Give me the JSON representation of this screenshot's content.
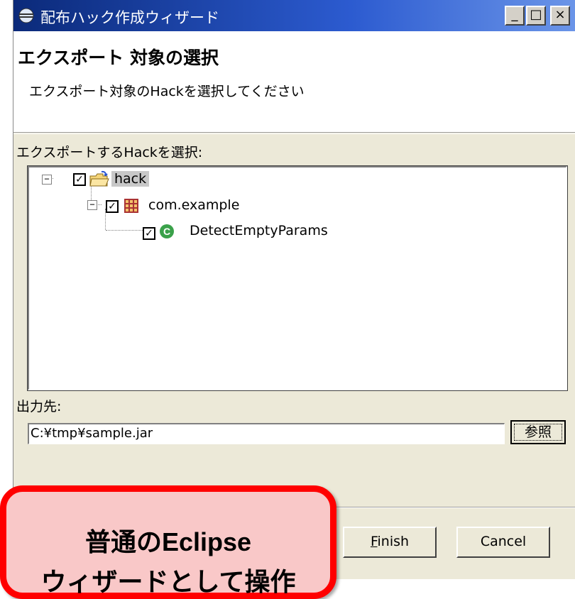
{
  "window": {
    "title": "配布ハック作成ウィザード",
    "controls": {
      "minimize": "_",
      "maximize": "□",
      "close": "×"
    }
  },
  "header": {
    "title": "エクスポート 対象の選択",
    "description": "エクスポート対象のHackを選択してください"
  },
  "tree": {
    "label": "エクスポートするHackを選択:",
    "items": [
      {
        "label": "hack",
        "checked": true,
        "expander": "−",
        "icon": "folder-icon"
      },
      {
        "label": "com.example",
        "checked": true,
        "expander": "−",
        "icon": "package-icon"
      },
      {
        "label": "DetectEmptyParams",
        "checked": true,
        "icon": "class-icon"
      }
    ]
  },
  "output": {
    "label": "出力先:",
    "value": "C:¥tmp¥sample.jar",
    "browse_label": "参照"
  },
  "buttons": {
    "finish_label": "Finish",
    "cancel_label": "Cancel"
  },
  "callout": {
    "line1": "普通のEclipse",
    "line2": "ウィザードとして操作"
  },
  "colors": {
    "titlebar_start": "#0b2a7a",
    "titlebar_end": "#6b95e8",
    "callout_fill": "#f9c8c8",
    "callout_border": "#ff0000",
    "selection": "#c8c8c8"
  }
}
